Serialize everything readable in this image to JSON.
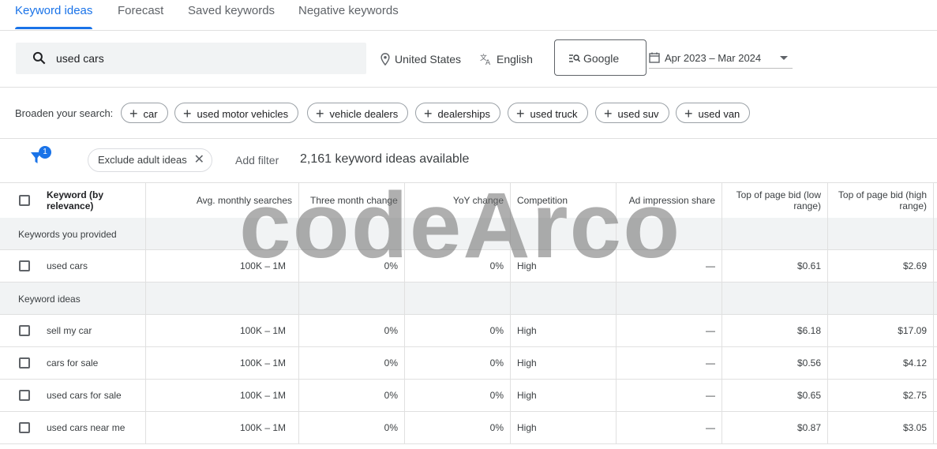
{
  "tabs": [
    {
      "label": "Keyword ideas",
      "active": true
    },
    {
      "label": "Forecast",
      "active": false
    },
    {
      "label": "Saved keywords",
      "active": false
    },
    {
      "label": "Negative keywords",
      "active": false
    }
  ],
  "search": {
    "query": "used cars",
    "location": "United States",
    "language": "English",
    "network": "Google",
    "date_range": "Apr 2023 – Mar 2024"
  },
  "broaden": {
    "label": "Broaden your search:",
    "chips": [
      "car",
      "used motor vehicles",
      "vehicle dealers",
      "dealerships",
      "used truck",
      "used suv",
      "used van"
    ]
  },
  "filters": {
    "badge_count": "1",
    "chip": "Exclude adult ideas",
    "add_filter": "Add filter",
    "count_text": "2,161 keyword ideas available"
  },
  "table": {
    "headers": [
      "Keyword (by relevance)",
      "Avg. monthly searches",
      "Three month change",
      "YoY change",
      "Competition",
      "Ad impression share",
      "Top of page bid (low range)",
      "Top of page bid (high range)"
    ],
    "sections": [
      {
        "label": "Keywords you provided",
        "rows": [
          [
            "used cars",
            "100K – 1M",
            "0%",
            "0%",
            "High",
            "—",
            "$0.61",
            "$2.69"
          ]
        ]
      },
      {
        "label": "Keyword ideas",
        "rows": [
          [
            "sell my car",
            "100K – 1M",
            "0%",
            "0%",
            "High",
            "—",
            "$6.18",
            "$17.09"
          ],
          [
            "cars for sale",
            "100K – 1M",
            "0%",
            "0%",
            "High",
            "—",
            "$0.56",
            "$4.12"
          ],
          [
            "used cars for sale",
            "100K – 1M",
            "0%",
            "0%",
            "High",
            "—",
            "$0.65",
            "$2.75"
          ],
          [
            "used cars near me",
            "100K – 1M",
            "0%",
            "0%",
            "High",
            "—",
            "$0.87",
            "$3.05"
          ]
        ]
      }
    ]
  },
  "watermark": "codeArco",
  "colors": {
    "accent": "#1a73e8",
    "section_bg": "#f1f3f4",
    "border": "#e0e0e0"
  }
}
